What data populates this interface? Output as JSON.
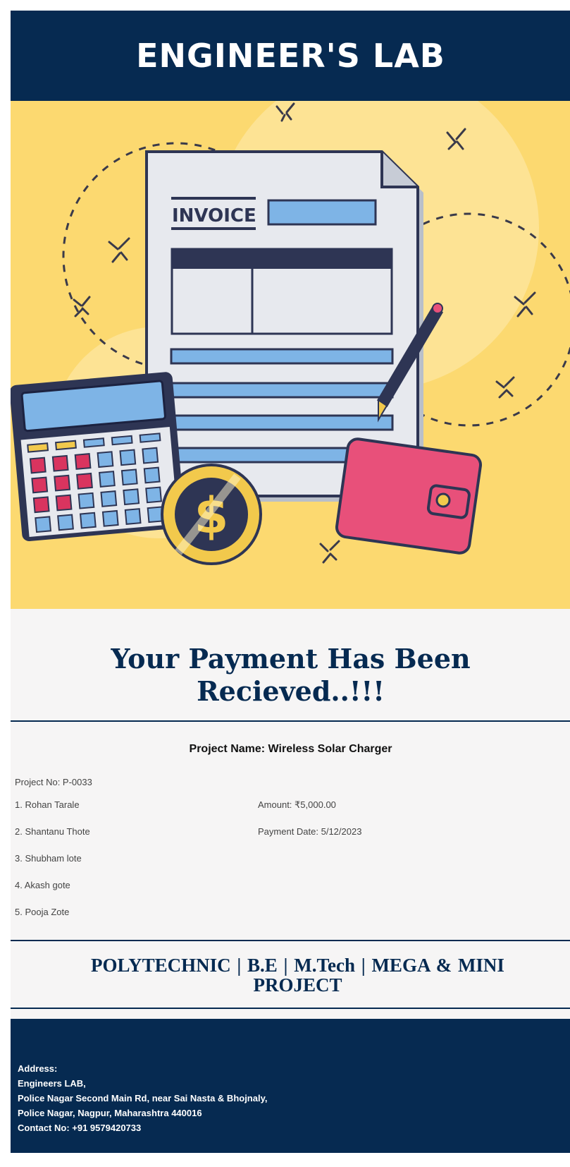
{
  "header": {
    "brand": "ENGINEER'S LAB"
  },
  "hero": {
    "invoice_label": "INVOICE",
    "currency_symbol": "$"
  },
  "content": {
    "headline_line1": "Your Payment Has Been",
    "headline_line2": "Recieved..!!!",
    "project_name": "Project Name: Wireless Solar Charger",
    "project_no": "Project No: P-0033",
    "members": [
      "1. Rohan Tarale",
      "2. Shantanu Thote",
      "3. Shubham lote",
      "4. Akash gote",
      "5. Pooja Zote"
    ],
    "amount": "Amount: ₹5,000.00",
    "payment_date": "Payment Date: 5/12/2023"
  },
  "tagline": "POLYTECHNIC  |  B.E  |  M.Tech  | MEGA & MINI PROJECT",
  "footer": {
    "address_label": "Address:",
    "line1": "Engineers LAB,",
    "line2": "Police Nagar Second Main Rd, near Sai Nasta & Bhojnaly,",
    "line3": "Police Nagar, Nagpur, Maharashtra 440016",
    "contact": "Contact No: +91 9579420733"
  },
  "colors": {
    "navy": "#062a51",
    "yellow": "#fcd970",
    "background": "#f6f5f5",
    "pink": "#e8507a",
    "blue": "#7eb4e6"
  }
}
